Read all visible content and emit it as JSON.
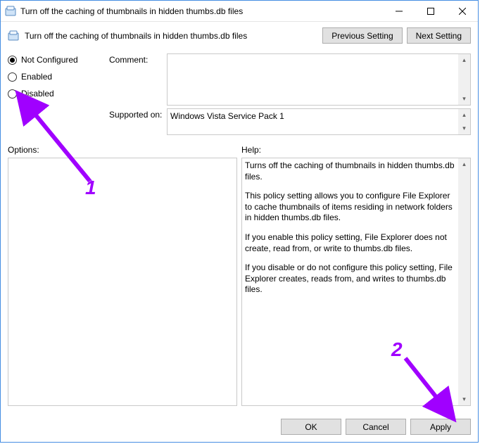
{
  "window": {
    "title": "Turn off the caching of thumbnails in hidden thumbs.db files"
  },
  "header": {
    "policy_title": "Turn off the caching of thumbnails in hidden thumbs.db files",
    "prev_btn": "Previous Setting",
    "next_btn": "Next Setting"
  },
  "state": {
    "not_configured": "Not Configured",
    "enabled": "Enabled",
    "disabled": "Disabled",
    "selected": "not_configured"
  },
  "labels": {
    "comment": "Comment:",
    "supported_on": "Supported on:",
    "options": "Options:",
    "help": "Help:"
  },
  "fields": {
    "comment": "",
    "supported_on": "Windows Vista Service Pack 1"
  },
  "help": {
    "p1": "Turns off the caching of thumbnails in hidden thumbs.db files.",
    "p2": "This policy setting allows you to configure File Explorer to cache thumbnails of items residing in network folders in hidden thumbs.db files.",
    "p3": "If you enable this policy setting, File Explorer does not create, read from, or write to thumbs.db files.",
    "p4": "If you disable or do not configure this policy setting, File Explorer creates, reads from, and writes to thumbs.db files."
  },
  "footer": {
    "ok": "OK",
    "cancel": "Cancel",
    "apply": "Apply"
  },
  "annotations": {
    "one": "1",
    "two": "2"
  }
}
